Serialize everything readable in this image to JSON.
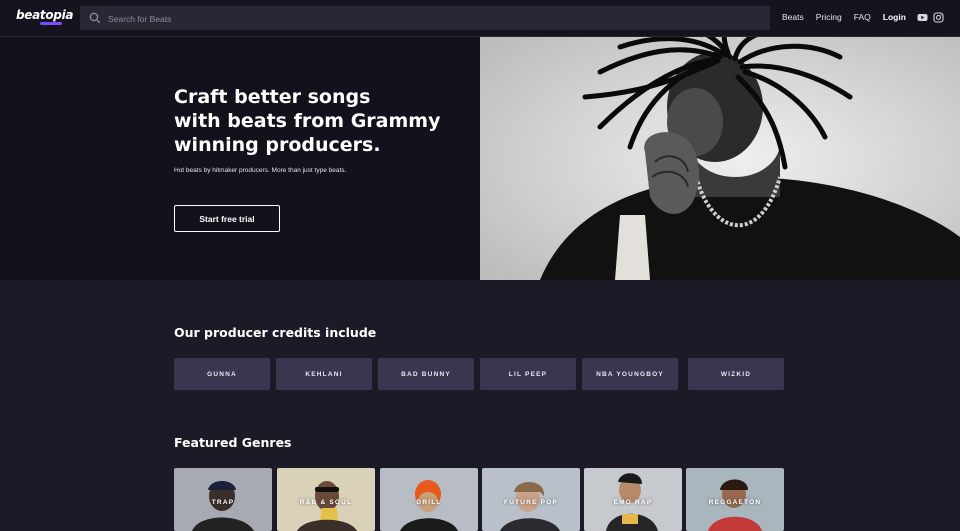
{
  "nav": {
    "logo": "beatopia",
    "search_placeholder": "Search for Beats",
    "links": [
      "Beats",
      "Pricing",
      "FAQ"
    ],
    "login": "Login",
    "social_icons": [
      "youtube-icon",
      "instagram-icon"
    ]
  },
  "hero": {
    "title_lines": [
      "Craft better songs",
      "with beats from Grammy",
      "winning producers."
    ],
    "subtitle": "Hot beats by hitmaker producers. More than just type beats.",
    "cta": "Start free trial"
  },
  "credits": {
    "title": "Our producer credits include",
    "items": [
      "GUNNA",
      "KEHLANI",
      "BAD BUNNY",
      "LIL PEEP",
      "NBA YOUNGBOY",
      "WIZKID"
    ]
  },
  "genres": {
    "title": "Featured Genres",
    "items": [
      {
        "label": "TRAP",
        "bg": "#a7aab3"
      },
      {
        "label": "R&B & SOUL",
        "bg": "#d9d2b8"
      },
      {
        "label": "DRILL",
        "bg": "#b8bcc4"
      },
      {
        "label": "FUTURE POP",
        "bg": "#b9c0c9"
      },
      {
        "label": "EMO RAP",
        "bg": "#c6c9cd"
      },
      {
        "label": "REGGAETON",
        "bg": "#a9b6bd"
      }
    ]
  },
  "colors": {
    "nav_bg": "#15131d",
    "hero_bg": "#13111b",
    "page_bg": "#1d1a27",
    "chip_bg": "#3a3650",
    "accent": "#7b4dff"
  }
}
